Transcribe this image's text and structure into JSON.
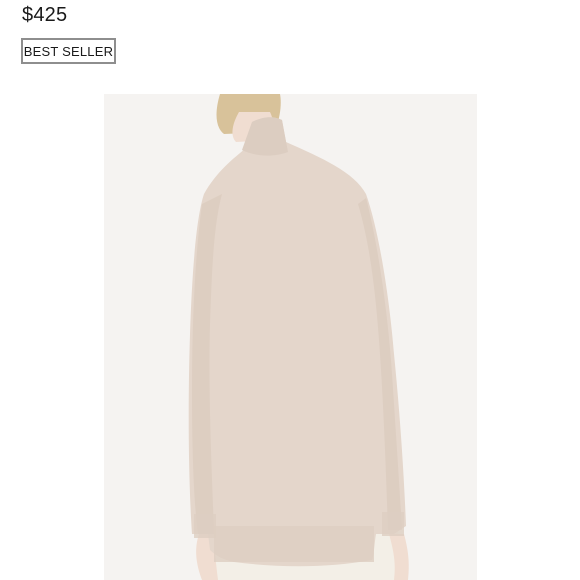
{
  "product": {
    "price": "$425",
    "badge_label": "BEST SELLER",
    "image": {
      "subject": "beige funnel-neck sweater, back view",
      "colors": {
        "background": "#f5f3f1",
        "sweater": "#e4d6cb",
        "sweater_shadow": "#d8c8bb",
        "skin": "#f0ddd1",
        "hair": "#d8c29a",
        "pants": "#f3efe7"
      }
    }
  }
}
